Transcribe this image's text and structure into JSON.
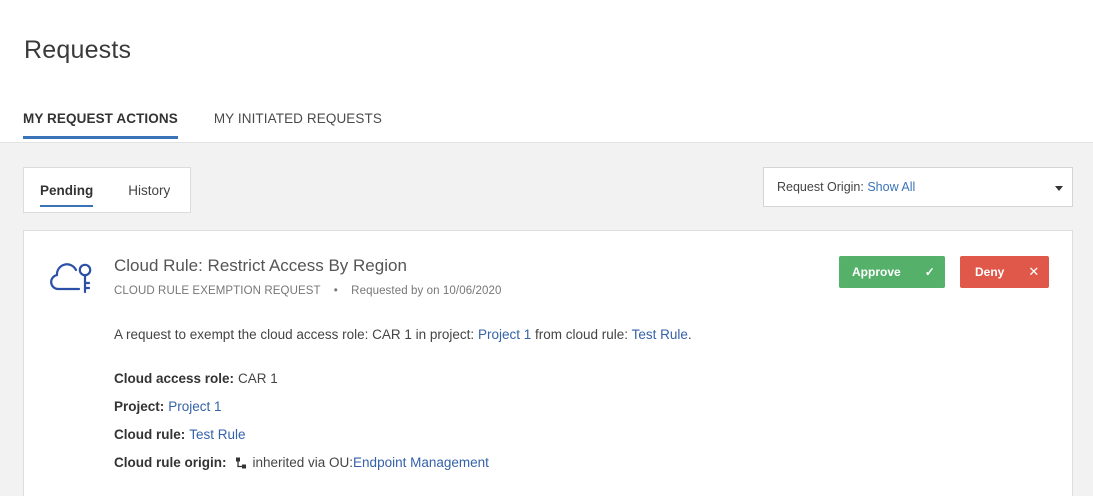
{
  "page": {
    "title": "Requests"
  },
  "main_tabs": [
    {
      "label": "MY REQUEST ACTIONS",
      "active": true
    },
    {
      "label": "MY INITIATED REQUESTS",
      "active": false
    }
  ],
  "sub_tabs": [
    {
      "label": "Pending",
      "active": true
    },
    {
      "label": "History",
      "active": false
    }
  ],
  "filter": {
    "label": "Request Origin:",
    "value": "Show All"
  },
  "request": {
    "icon": "cloud-key-icon",
    "title": "Cloud Rule: Restrict Access By Region",
    "type": "CLOUD RULE EXEMPTION REQUEST",
    "separator": "•",
    "requested": "Requested by on 10/06/2020",
    "approve_label": "Approve",
    "deny_label": "Deny",
    "description": {
      "prefix": "A request to exempt the cloud access role: CAR 1 in project:",
      "project_link": "Project 1",
      "middle": "from cloud rule:",
      "rule_link": "Test Rule",
      "suffix": "."
    },
    "fields": {
      "role_label": "Cloud access role:",
      "role_value": "CAR 1",
      "project_label": "Project:",
      "project_value": "Project 1",
      "rule_label": "Cloud rule:",
      "rule_value": "Test Rule",
      "origin_label": "Cloud rule origin:",
      "origin_text": "inherited via OU:",
      "origin_link": "Endpoint Management"
    }
  },
  "colors": {
    "accent": "#3b73b9",
    "approve": "#55b06a",
    "deny": "#e0584a",
    "link": "#3562a8"
  }
}
